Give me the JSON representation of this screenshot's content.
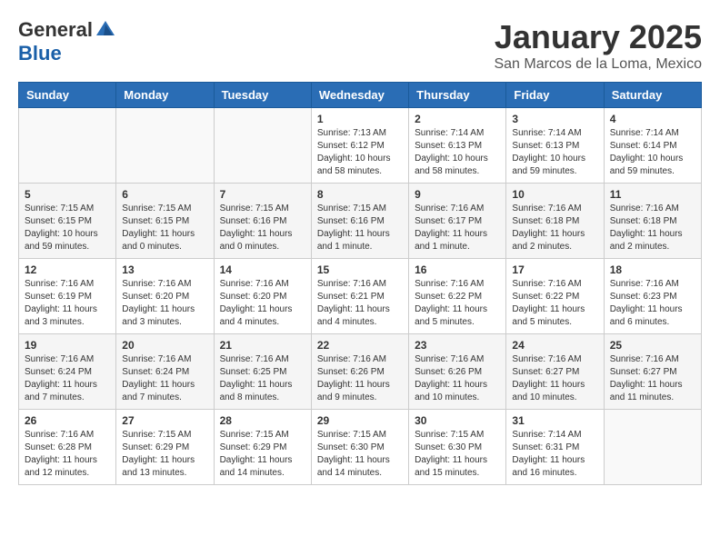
{
  "logo": {
    "general": "General",
    "blue": "Blue"
  },
  "title": "January 2025",
  "location": "San Marcos de la Loma, Mexico",
  "days_of_week": [
    "Sunday",
    "Monday",
    "Tuesday",
    "Wednesday",
    "Thursday",
    "Friday",
    "Saturday"
  ],
  "weeks": [
    [
      {
        "day": "",
        "info": ""
      },
      {
        "day": "",
        "info": ""
      },
      {
        "day": "",
        "info": ""
      },
      {
        "day": "1",
        "info": "Sunrise: 7:13 AM\nSunset: 6:12 PM\nDaylight: 10 hours\nand 58 minutes."
      },
      {
        "day": "2",
        "info": "Sunrise: 7:14 AM\nSunset: 6:13 PM\nDaylight: 10 hours\nand 58 minutes."
      },
      {
        "day": "3",
        "info": "Sunrise: 7:14 AM\nSunset: 6:13 PM\nDaylight: 10 hours\nand 59 minutes."
      },
      {
        "day": "4",
        "info": "Sunrise: 7:14 AM\nSunset: 6:14 PM\nDaylight: 10 hours\nand 59 minutes."
      }
    ],
    [
      {
        "day": "5",
        "info": "Sunrise: 7:15 AM\nSunset: 6:15 PM\nDaylight: 10 hours\nand 59 minutes."
      },
      {
        "day": "6",
        "info": "Sunrise: 7:15 AM\nSunset: 6:15 PM\nDaylight: 11 hours\nand 0 minutes."
      },
      {
        "day": "7",
        "info": "Sunrise: 7:15 AM\nSunset: 6:16 PM\nDaylight: 11 hours\nand 0 minutes."
      },
      {
        "day": "8",
        "info": "Sunrise: 7:15 AM\nSunset: 6:16 PM\nDaylight: 11 hours\nand 1 minute."
      },
      {
        "day": "9",
        "info": "Sunrise: 7:16 AM\nSunset: 6:17 PM\nDaylight: 11 hours\nand 1 minute."
      },
      {
        "day": "10",
        "info": "Sunrise: 7:16 AM\nSunset: 6:18 PM\nDaylight: 11 hours\nand 2 minutes."
      },
      {
        "day": "11",
        "info": "Sunrise: 7:16 AM\nSunset: 6:18 PM\nDaylight: 11 hours\nand 2 minutes."
      }
    ],
    [
      {
        "day": "12",
        "info": "Sunrise: 7:16 AM\nSunset: 6:19 PM\nDaylight: 11 hours\nand 3 minutes."
      },
      {
        "day": "13",
        "info": "Sunrise: 7:16 AM\nSunset: 6:20 PM\nDaylight: 11 hours\nand 3 minutes."
      },
      {
        "day": "14",
        "info": "Sunrise: 7:16 AM\nSunset: 6:20 PM\nDaylight: 11 hours\nand 4 minutes."
      },
      {
        "day": "15",
        "info": "Sunrise: 7:16 AM\nSunset: 6:21 PM\nDaylight: 11 hours\nand 4 minutes."
      },
      {
        "day": "16",
        "info": "Sunrise: 7:16 AM\nSunset: 6:22 PM\nDaylight: 11 hours\nand 5 minutes."
      },
      {
        "day": "17",
        "info": "Sunrise: 7:16 AM\nSunset: 6:22 PM\nDaylight: 11 hours\nand 5 minutes."
      },
      {
        "day": "18",
        "info": "Sunrise: 7:16 AM\nSunset: 6:23 PM\nDaylight: 11 hours\nand 6 minutes."
      }
    ],
    [
      {
        "day": "19",
        "info": "Sunrise: 7:16 AM\nSunset: 6:24 PM\nDaylight: 11 hours\nand 7 minutes."
      },
      {
        "day": "20",
        "info": "Sunrise: 7:16 AM\nSunset: 6:24 PM\nDaylight: 11 hours\nand 7 minutes."
      },
      {
        "day": "21",
        "info": "Sunrise: 7:16 AM\nSunset: 6:25 PM\nDaylight: 11 hours\nand 8 minutes."
      },
      {
        "day": "22",
        "info": "Sunrise: 7:16 AM\nSunset: 6:26 PM\nDaylight: 11 hours\nand 9 minutes."
      },
      {
        "day": "23",
        "info": "Sunrise: 7:16 AM\nSunset: 6:26 PM\nDaylight: 11 hours\nand 10 minutes."
      },
      {
        "day": "24",
        "info": "Sunrise: 7:16 AM\nSunset: 6:27 PM\nDaylight: 11 hours\nand 10 minutes."
      },
      {
        "day": "25",
        "info": "Sunrise: 7:16 AM\nSunset: 6:27 PM\nDaylight: 11 hours\nand 11 minutes."
      }
    ],
    [
      {
        "day": "26",
        "info": "Sunrise: 7:16 AM\nSunset: 6:28 PM\nDaylight: 11 hours\nand 12 minutes."
      },
      {
        "day": "27",
        "info": "Sunrise: 7:15 AM\nSunset: 6:29 PM\nDaylight: 11 hours\nand 13 minutes."
      },
      {
        "day": "28",
        "info": "Sunrise: 7:15 AM\nSunset: 6:29 PM\nDaylight: 11 hours\nand 14 minutes."
      },
      {
        "day": "29",
        "info": "Sunrise: 7:15 AM\nSunset: 6:30 PM\nDaylight: 11 hours\nand 14 minutes."
      },
      {
        "day": "30",
        "info": "Sunrise: 7:15 AM\nSunset: 6:30 PM\nDaylight: 11 hours\nand 15 minutes."
      },
      {
        "day": "31",
        "info": "Sunrise: 7:14 AM\nSunset: 6:31 PM\nDaylight: 11 hours\nand 16 minutes."
      },
      {
        "day": "",
        "info": ""
      }
    ]
  ]
}
